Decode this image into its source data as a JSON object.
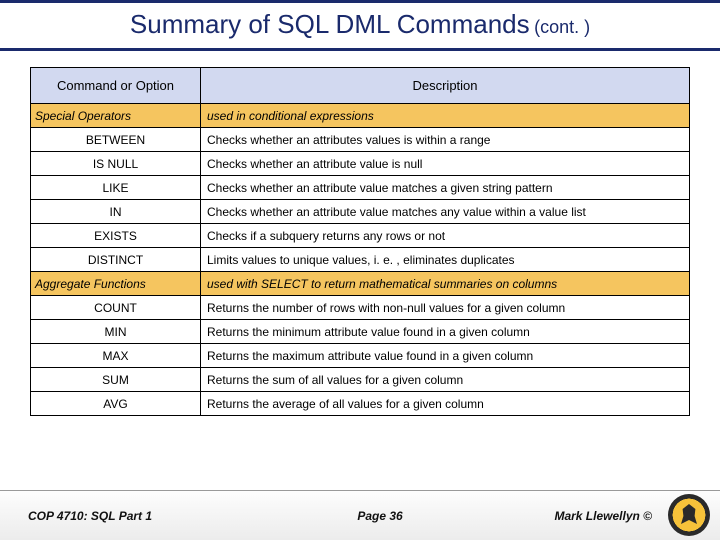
{
  "title": "Summary of SQL DML Commands",
  "title_cont": "(cont. )",
  "headers": {
    "col1": "Command or Option",
    "col2": "Description"
  },
  "sections": [
    {
      "name": "Special Operators",
      "desc": "used in conditional expressions",
      "rows": [
        {
          "cmd": "BETWEEN",
          "desc": "Checks whether an attributes values is within a range"
        },
        {
          "cmd": "IS NULL",
          "desc": "Checks whether an attribute value is null"
        },
        {
          "cmd": "LIKE",
          "desc": "Checks whether an attribute value matches a given string pattern"
        },
        {
          "cmd": "IN",
          "desc": "Checks whether an attribute value matches any value within a value list"
        },
        {
          "cmd": "EXISTS",
          "desc": "Checks if a subquery returns any rows or not"
        },
        {
          "cmd": "DISTINCT",
          "desc": "Limits values to unique values, i. e. , eliminates duplicates"
        }
      ]
    },
    {
      "name": "Aggregate Functions",
      "desc": "used with SELECT to return mathematical summaries on columns",
      "rows": [
        {
          "cmd": "COUNT",
          "desc": "Returns the number of rows with non-null values for a given column"
        },
        {
          "cmd": "MIN",
          "desc": "Returns the minimum attribute value found in a given column"
        },
        {
          "cmd": "MAX",
          "desc": "Returns the maximum attribute value found in a given column"
        },
        {
          "cmd": "SUM",
          "desc": "Returns the sum of all values for a given column"
        },
        {
          "cmd": "AVG",
          "desc": "Returns the average of all values for a given column"
        }
      ]
    }
  ],
  "footer": {
    "course": "COP 4710: SQL Part 1",
    "page": "Page 36",
    "author": "Mark Llewellyn ©"
  },
  "chart_data": {
    "type": "table",
    "title": "Summary of SQL DML Commands (cont.)",
    "columns": [
      "Command or Option",
      "Description"
    ],
    "rows": [
      [
        "Special Operators",
        "used in conditional expressions"
      ],
      [
        "BETWEEN",
        "Checks whether an attributes values is within a range"
      ],
      [
        "IS NULL",
        "Checks whether an attribute value is null"
      ],
      [
        "LIKE",
        "Checks whether an attribute value matches a given string pattern"
      ],
      [
        "IN",
        "Checks whether an attribute value matches any value within a value list"
      ],
      [
        "EXISTS",
        "Checks if a subquery returns any rows or not"
      ],
      [
        "DISTINCT",
        "Limits values to unique values, i. e. , eliminates duplicates"
      ],
      [
        "Aggregate Functions",
        "used with SELECT to return mathematical summaries on columns"
      ],
      [
        "COUNT",
        "Returns the number of rows with non-null values for a given column"
      ],
      [
        "MIN",
        "Returns the minimum attribute value found in a given column"
      ],
      [
        "MAX",
        "Returns the maximum attribute value found in a given column"
      ],
      [
        "SUM",
        "Returns the sum of all values for a given column"
      ],
      [
        "AVG",
        "Returns the average of all values for a given column"
      ]
    ]
  }
}
